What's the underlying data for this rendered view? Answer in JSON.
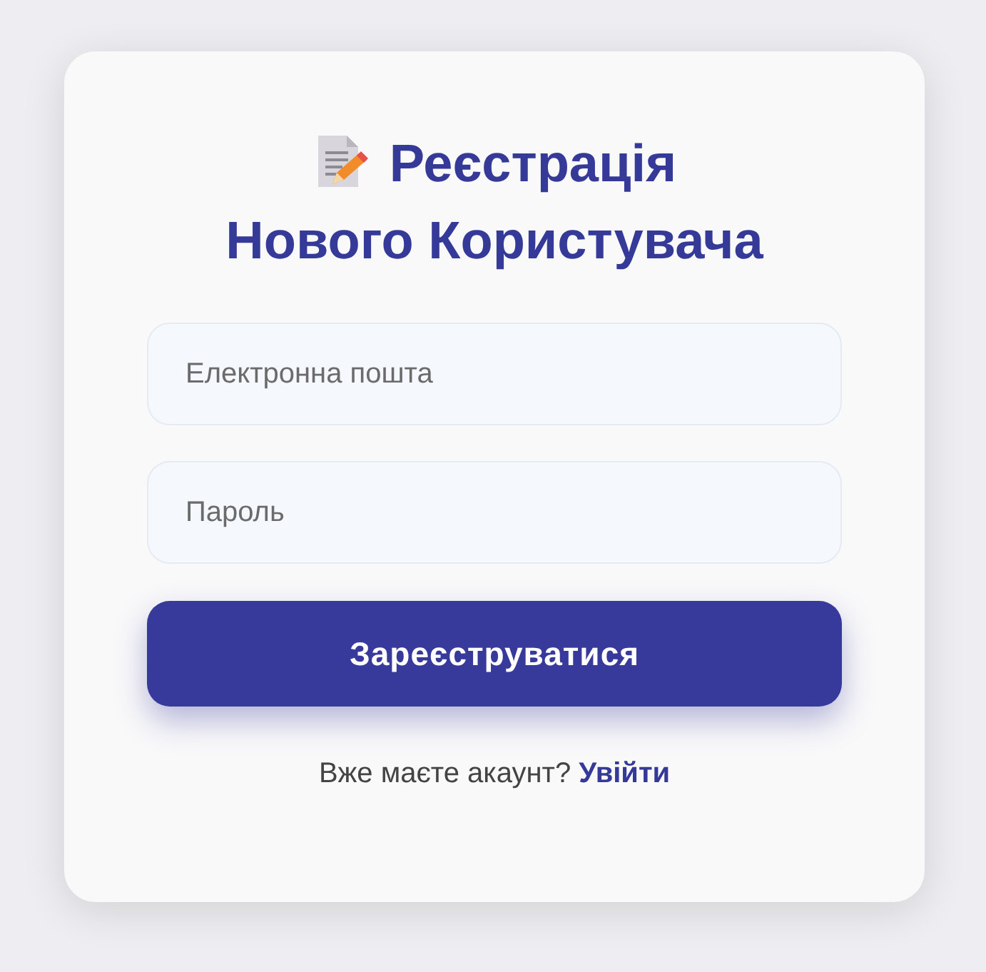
{
  "title_lines": [
    "Реєстрація",
    "Нового Користувача"
  ],
  "fields": [
    {
      "placeholder": "Електронна пошта"
    },
    {
      "placeholder": "Пароль"
    }
  ],
  "button": "Зареєструватися",
  "footer": {
    "text": "Вже маєте акаунт?",
    "link": "Увійти"
  }
}
